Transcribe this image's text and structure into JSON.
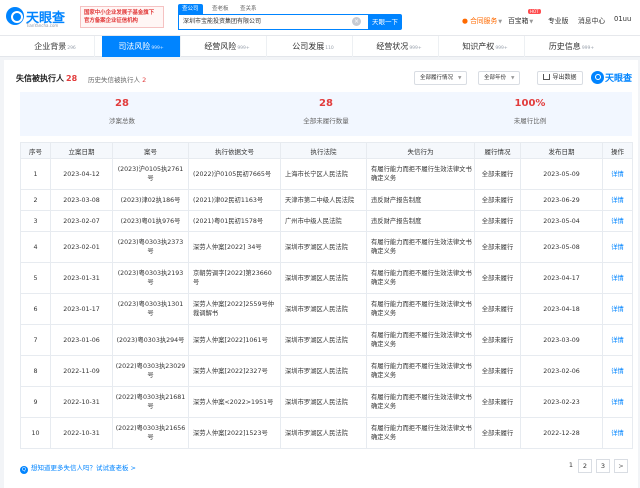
{
  "header": {
    "logo_text": "天眼查",
    "logo_sub": "TianYancha.com",
    "promo_line1": "国家中小企业发展子基金旗下",
    "promo_line2": "官方备案企业征信机构",
    "search_tabs": [
      "查公司",
      "查老板",
      "查关系"
    ],
    "search_value": "深圳市宝能投资集团有限公司",
    "search_clear_icon": "close-circle-icon",
    "search_button": "天眼一下",
    "nav": {
      "cooperation": "合同服务",
      "baike": "百宝箱",
      "hot_badge": "HOT",
      "pro": "专业版",
      "messages": "消息中心",
      "user": "01uu"
    }
  },
  "subnav": {
    "tabs": [
      {
        "label": "企业背景",
        "count": "296"
      },
      {
        "label": "司法风险",
        "count": "999+"
      },
      {
        "label": "经营风险",
        "count": "999+"
      },
      {
        "label": "公司发展",
        "count": "110"
      },
      {
        "label": "经营状况",
        "count": "999+"
      },
      {
        "label": "知识产权",
        "count": "999+"
      },
      {
        "label": "历史信息",
        "count": "999+"
      }
    ],
    "active_index": 1
  },
  "section": {
    "title": "失信被执行人",
    "title_count": "28",
    "history_label": "历史失信被执行人",
    "history_count": "2",
    "filter_status": "全部履行情况",
    "filter_year": "全部年份",
    "export_label": "导出数据",
    "brand": "天眼查"
  },
  "stats": [
    {
      "value": "28",
      "label": "涉案总数"
    },
    {
      "value": "28",
      "label": "全部未履行数量"
    },
    {
      "value": "100%",
      "label": "未履行比例"
    }
  ],
  "table": {
    "columns": [
      "序号",
      "立案日期",
      "案号",
      "执行依据文号",
      "执行法院",
      "失信行为",
      "履行情况",
      "发布日期",
      "操作"
    ],
    "rows": [
      [
        "1",
        "2023-04-12",
        "(2023)沪0105执2761号",
        "(2022)沪0105民初7665号",
        "上海市长宁区人民法院",
        "有履行能力而拒不履行生效法律文书确定义务",
        "全部未履行",
        "2023-05-09",
        "详情"
      ],
      [
        "2",
        "2023-03-08",
        "(2023)津02执186号",
        "(2021)津02民初1163号",
        "天津市第二中级人民法院",
        "违反财产报告制度",
        "全部未履行",
        "2023-06-29",
        "详情"
      ],
      [
        "3",
        "2023-02-07",
        "(2023)粤01执976号",
        "(2021)粤01民初1578号",
        "广州市中级人民法院",
        "违反财产报告制度",
        "全部未履行",
        "2023-05-04",
        "详情"
      ],
      [
        "4",
        "2023-02-01",
        "(2023)粤0303执2373号",
        "深劳人仲案[2022] 34号",
        "深圳市罗湖区人民法院",
        "有履行能力而拒不履行生效法律文书确定义务",
        "全部未履行",
        "2023-05-08",
        "详情"
      ],
      [
        "5",
        "2023-01-31",
        "(2023)粤0303执2193号",
        "京朝劳调字[2022]第23660号",
        "深圳市罗湖区人民法院",
        "有履行能力而拒不履行生效法律文书确定义务",
        "全部未履行",
        "2023-04-17",
        "详情"
      ],
      [
        "6",
        "2023-01-17",
        "(2023)粤0303执1301号",
        "深劳人仲案[2022]2559号仲裁调解书",
        "深圳市罗湖区人民法院",
        "有履行能力而拒不履行生效法律文书确定义务",
        "全部未履行",
        "2023-04-18",
        "详情"
      ],
      [
        "7",
        "2023-01-06",
        "(2023)粤0303执294号",
        "深劳人仲案[2022]1061号",
        "深圳市罗湖区人民法院",
        "有履行能力而拒不履行生效法律文书确定义务",
        "全部未履行",
        "2023-03-09",
        "详情"
      ],
      [
        "8",
        "2022-11-09",
        "(2022)粤0303执23029号",
        "深劳人仲案[2022]2327号",
        "深圳市罗湖区人民法院",
        "有履行能力而拒不履行生效法律文书确定义务",
        "全部未履行",
        "2023-02-06",
        "详情"
      ],
      [
        "9",
        "2022-10-31",
        "(2022)粤0303执21681号",
        "深劳人仲案<2022>1951号",
        "深圳市罗湖区人民法院",
        "有履行能力而拒不履行生效法律文书确定义务",
        "全部未履行",
        "2023-02-23",
        "详情"
      ],
      [
        "10",
        "2022-10-31",
        "(2022)粤0303执21656号",
        "深劳人仲案[2022]1523号",
        "深圳市罗湖区人民法院",
        "有履行能力而拒不履行生效法律文书确定义务",
        "全部未履行",
        "2022-12-28",
        "详情"
      ]
    ]
  },
  "footer": {
    "ad_link": "想知道更多失信人吗？试试查老板",
    "pages": [
      "1",
      "2",
      "3"
    ],
    "next": ">"
  },
  "colors": {
    "accent": "#0084ff",
    "alert": "#e23c3c",
    "stats_bg": "#f2f7ff"
  }
}
